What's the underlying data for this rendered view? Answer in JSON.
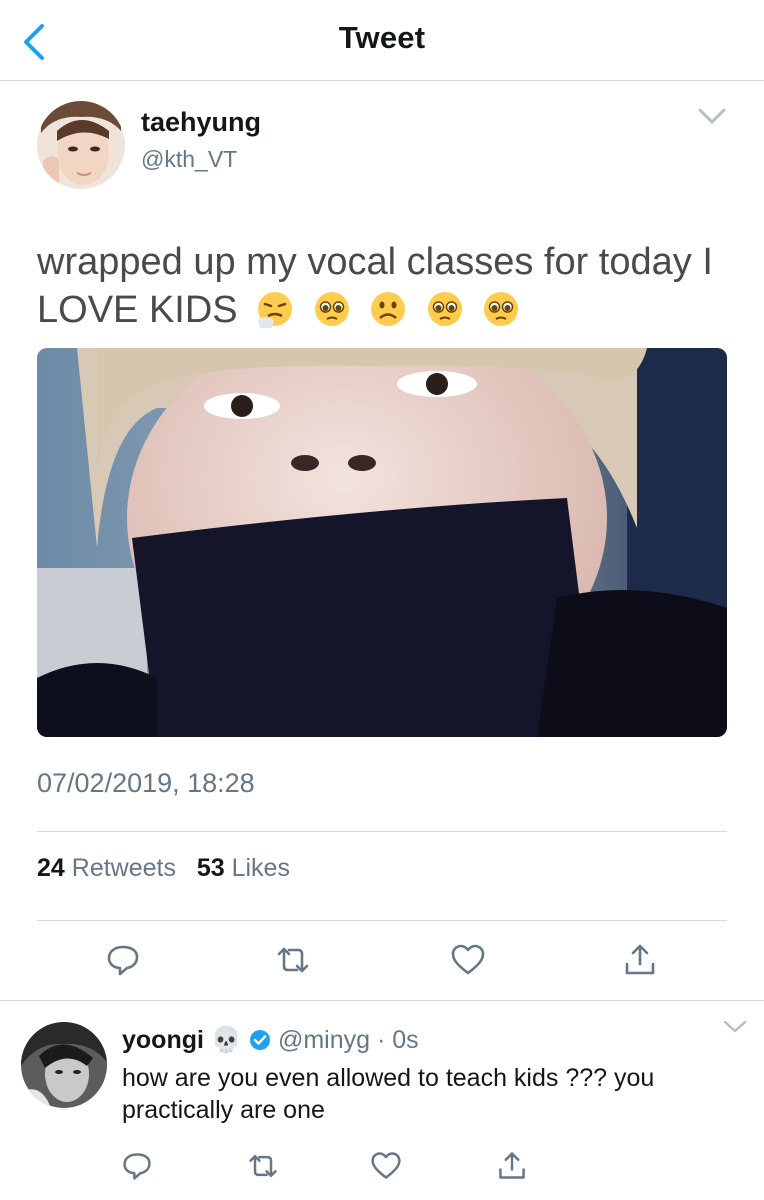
{
  "header": {
    "title": "Tweet"
  },
  "tweet": {
    "author_name": "taehyung",
    "author_handle": "@kth_VT",
    "text": "wrapped up my vocal classes for today I LOVE KIDS",
    "emojis": [
      "sneezing-face",
      "pleading-face",
      "frowning-face",
      "pleading-face",
      "pleading-face"
    ],
    "timestamp": "07/02/2019, 18:28",
    "retweet_count": "24",
    "retweet_label": "Retweets",
    "like_count": "53",
    "like_label": "Likes"
  },
  "reply": {
    "author_name": "yoongi",
    "name_emoji": "💀",
    "author_handle": "@minyg",
    "separator": "·",
    "time": "0s",
    "text": "how are you even allowed to teach kids ??? you practically are one"
  },
  "icons": {
    "back": "back-chevron-icon",
    "menu": "chevron-down-icon",
    "reply": "reply-icon",
    "retweet": "retweet-icon",
    "like": "heart-icon",
    "share": "share-icon",
    "verified": "verified-badge-icon"
  },
  "colors": {
    "accent": "#1da1f2",
    "secondary_text": "#657786",
    "divider": "#d5d9dc"
  }
}
